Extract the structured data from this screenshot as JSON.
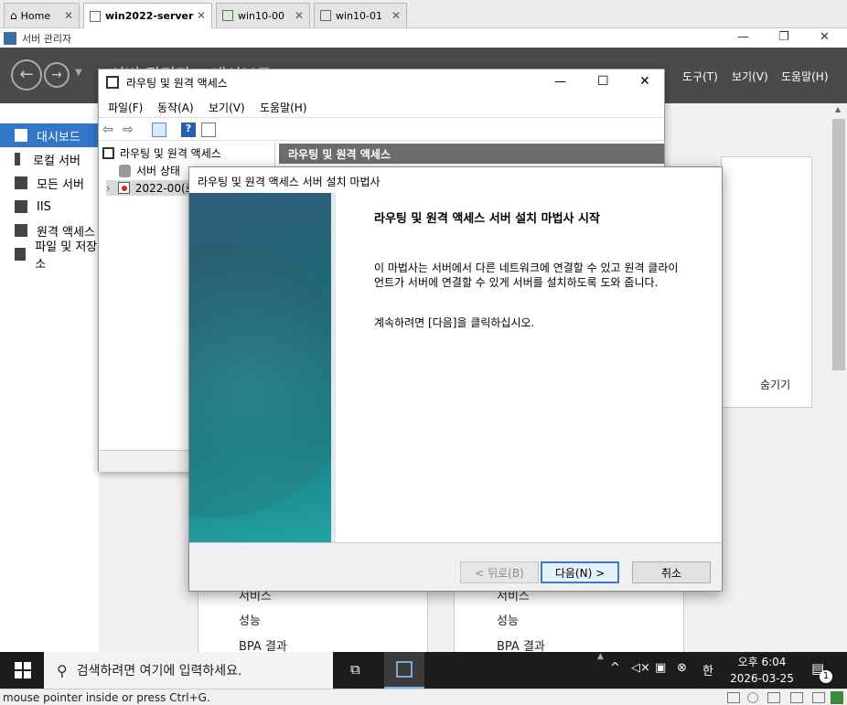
{
  "vm_tabs": [
    {
      "label": "Home"
    },
    {
      "label": "win2022-server"
    },
    {
      "label": "win10-00"
    },
    {
      "label": "win10-01"
    }
  ],
  "server_manager": {
    "window_title": "서버 관리자",
    "header_title": "서버 관리자 • 대시보드",
    "menu": [
      "도구(T)",
      "보기(V)",
      "도움말(H)"
    ],
    "nav": [
      "대시보드",
      "로컬 서버",
      "모든 서버",
      "IIS",
      "원격 액세스",
      "파일 및 저장소"
    ],
    "hide_link": "숨기기",
    "tile_items": [
      "서비스",
      "성능",
      "BPA 결과"
    ]
  },
  "rras": {
    "title": "라우팅 및 원격 액세스",
    "menu": [
      "파일(F)",
      "동작(A)",
      "보기(V)",
      "도움말(H)"
    ],
    "tree": {
      "root": "라우팅 및 원격 액세스",
      "server_status": "서버 상태",
      "server": "2022-00(로컬)"
    },
    "right_header": "라우팅 및 원격 액세스"
  },
  "wizard": {
    "title": "라우팅 및 원격 액세스 서버 설치 마법사",
    "heading": "라우팅 및 원격 액세스 서버 설치 마법사 시작",
    "paragraph": "이 마법사는 서버에서 다른 네트워크에 연결할 수 있고 원격 클라이언트가 서버에 연결할 수 있게 서버를 설치하도록 도와 줍니다.",
    "continue_text": "계속하려면 [다음]을 클릭하십시오.",
    "back_button": "< 뒤로(B)",
    "next_button": "다음(N) >",
    "cancel_button": "취소"
  },
  "taskbar": {
    "search_placeholder": "검색하려면 여기에 입력하세요.",
    "ime": "한",
    "time": "오후 6:04",
    "date": "2026-03-25",
    "notification_count": "1"
  },
  "vm_status_text": "mouse pointer inside or press Ctrl+G."
}
